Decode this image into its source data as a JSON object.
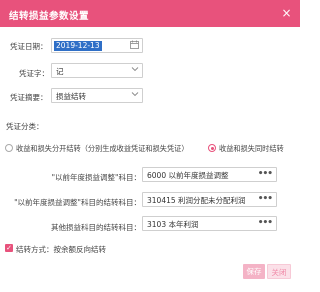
{
  "dialog": {
    "title": "结转损益参数设置",
    "close_icon": "×"
  },
  "form": {
    "date": {
      "label": "凭证日期：",
      "value": "2019-12-13",
      "icon": "calendar-icon"
    },
    "voucher_word": {
      "label": "凭证字：",
      "value": "记"
    },
    "summary": {
      "label": "凭证摘要：",
      "value": "损益结转"
    },
    "category": {
      "label": "凭证分类："
    },
    "options": [
      {
        "label": "收益和损失分开结转（分别生成收益凭证和损失凭证）",
        "selected": false
      },
      {
        "label": "收益和损失同时结转",
        "selected": true
      }
    ],
    "subjects": [
      {
        "label": "\"以前年度损益调整\"科目：",
        "value": "6000 以前年度损益调整"
      },
      {
        "label": "\"以前年度损益调整\"科目的结转科目：",
        "value": "310415 利润分配未分配利润"
      },
      {
        "label": "其他损益科目的结转科目：",
        "value": "3103 本年利润"
      }
    ],
    "transfer_method": {
      "label": "结转方式：按余额反向结转",
      "checked": true
    }
  },
  "buttons": {
    "save": "保存",
    "close": "关闭"
  },
  "colors": {
    "accent": "#e8527c"
  }
}
